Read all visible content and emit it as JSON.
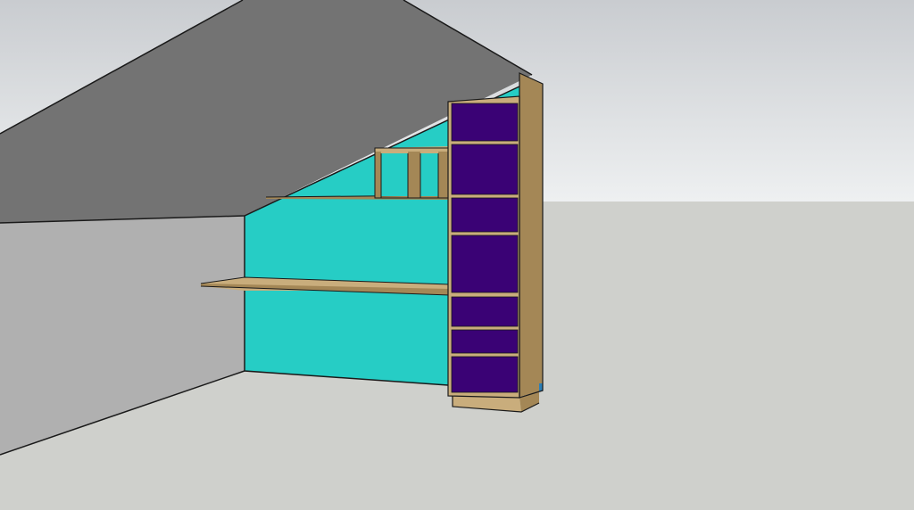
{
  "viewport": {
    "label": "",
    "colors": {
      "sky_top": "#c9ccd0",
      "sky_bottom": "#eef0f1",
      "ground": "#cfd0cc",
      "sloped_ceiling": "#737373",
      "left_wall": "#b0b0b0",
      "back_wall": "#26cdc5",
      "cabinet_panel": "#3a0275",
      "wood": "#a48756",
      "wood_light": "#c9ad7c",
      "edge": "#1a1a1a"
    }
  },
  "scene": {
    "objects": [
      "sloped-ceiling",
      "left-wall",
      "back-wall",
      "desk-shelf",
      "upper-shelf",
      "small-bookcase",
      "tall-cabinet"
    ]
  }
}
